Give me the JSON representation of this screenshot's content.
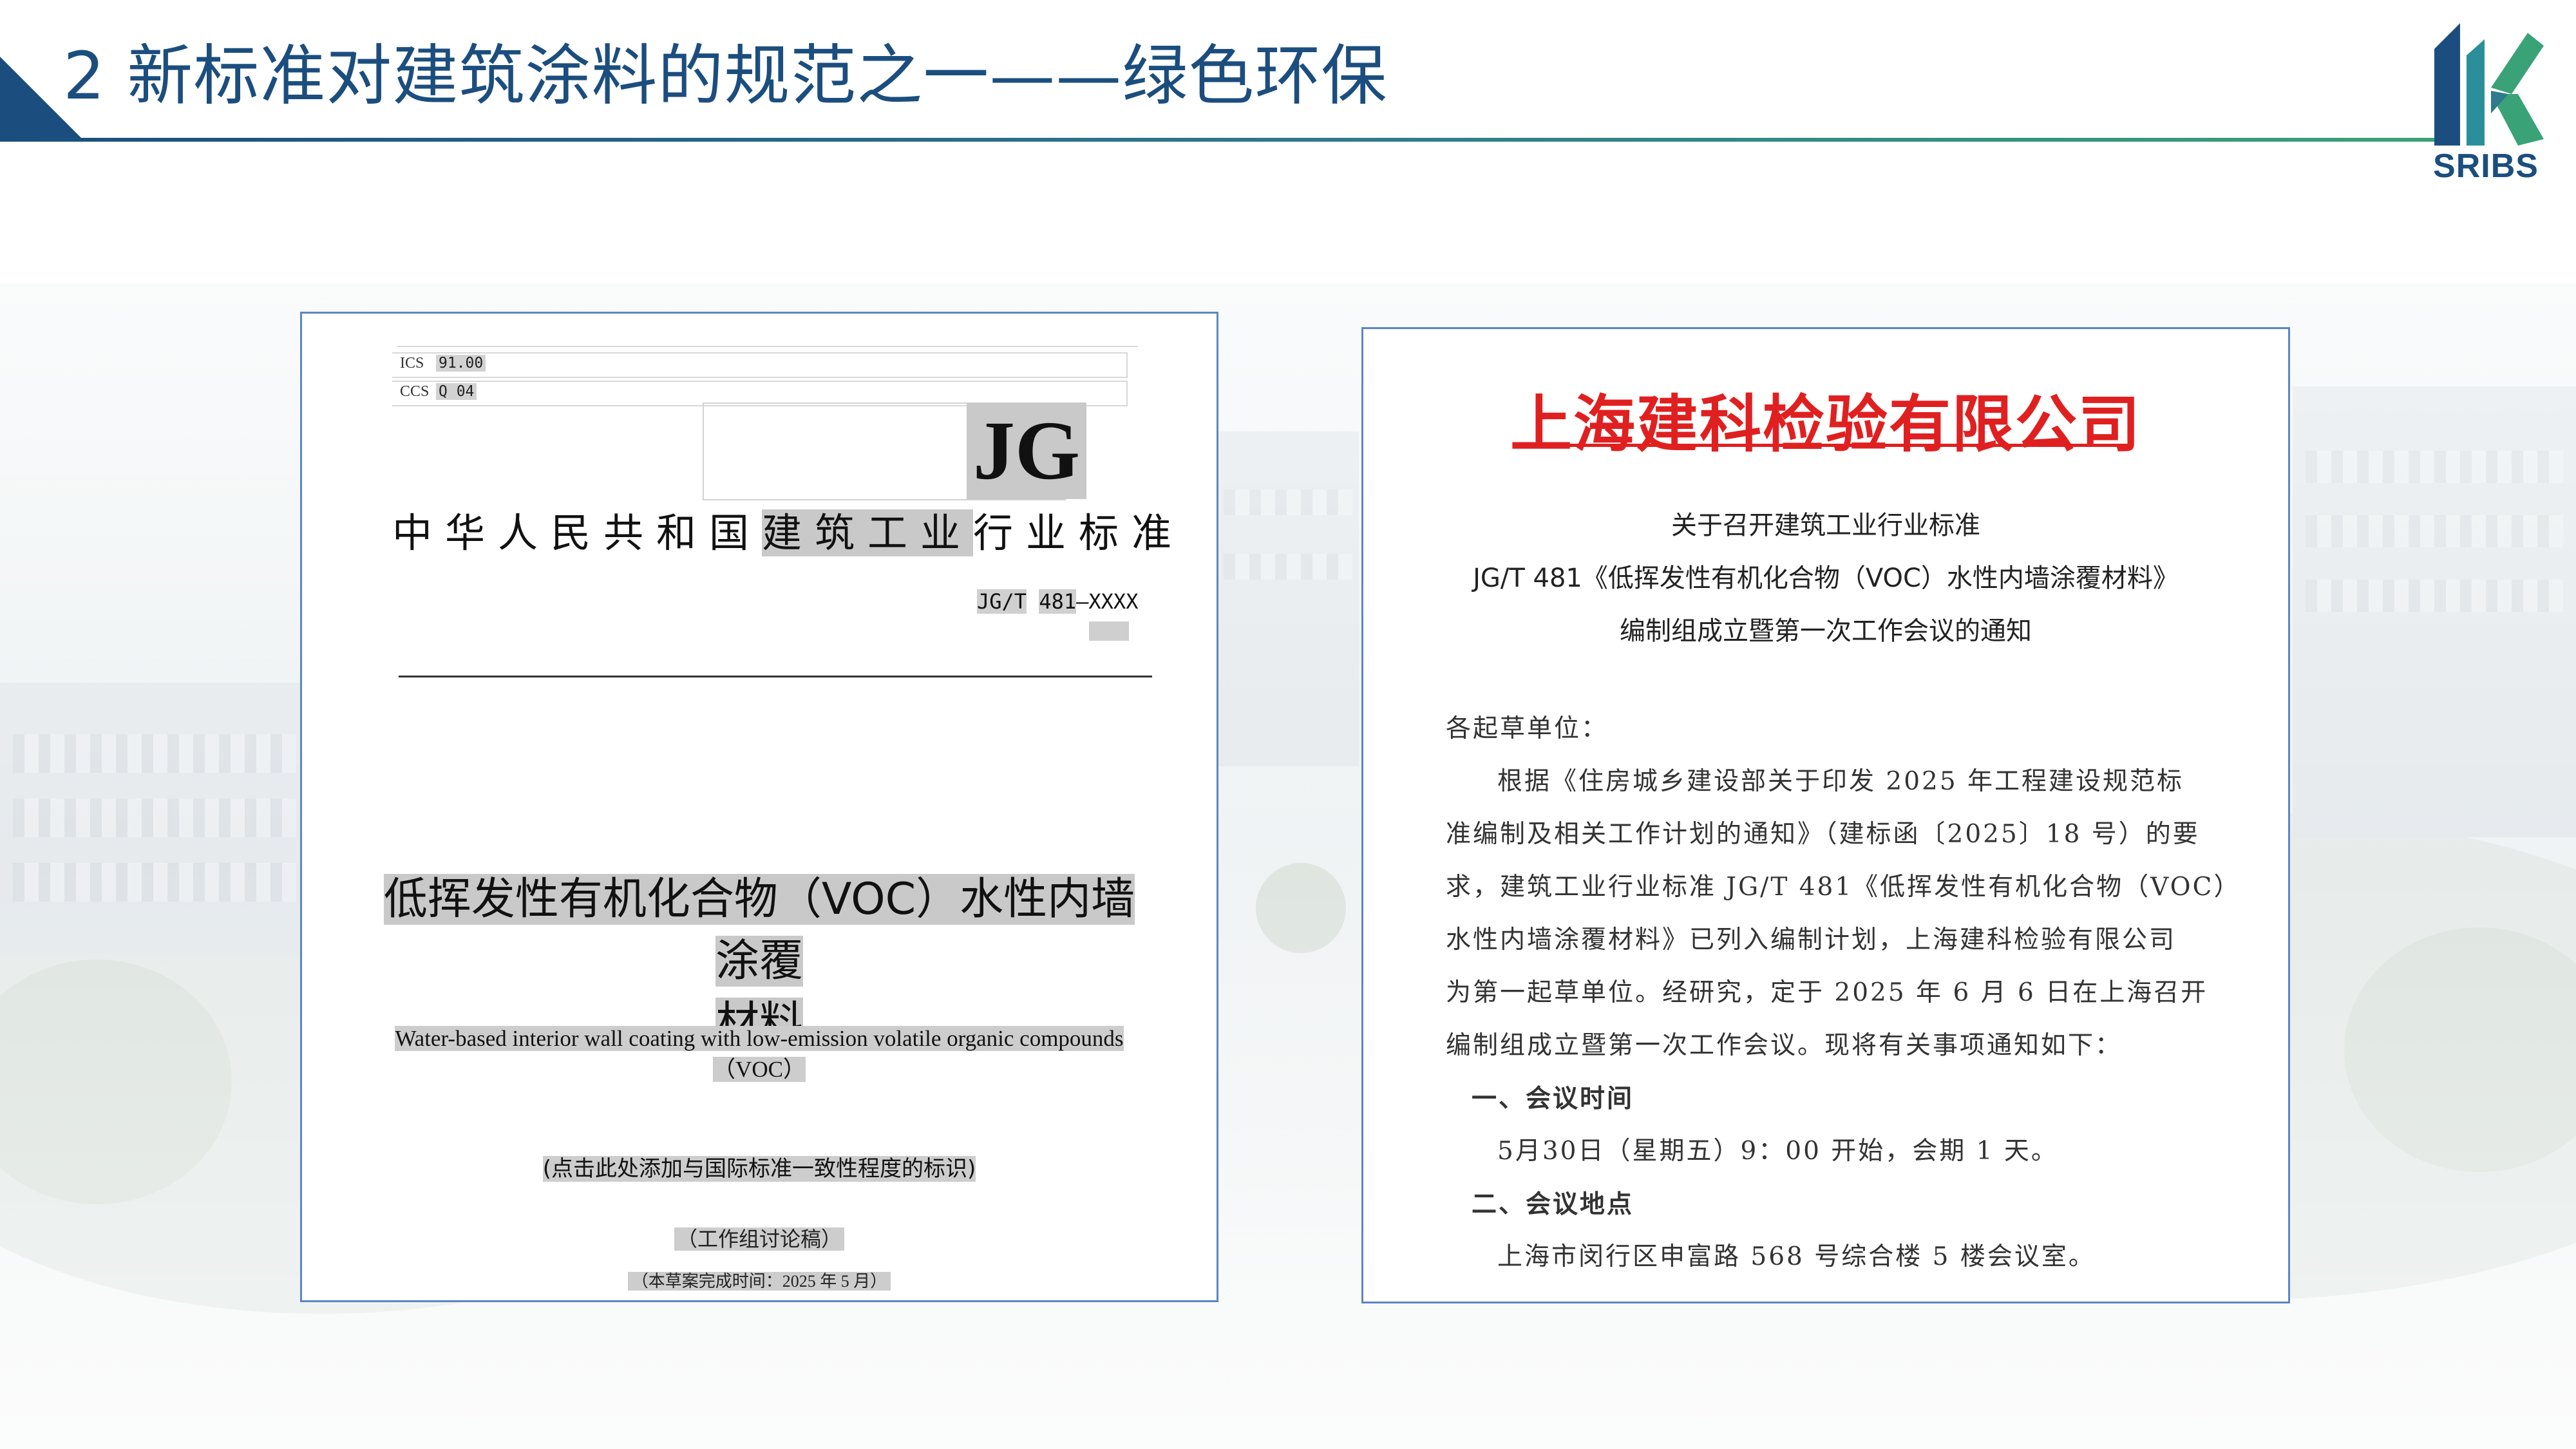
{
  "slide": {
    "title": "2 新标准对建筑涂料的规范之一——绿色环保",
    "logo_text": "SRIBS",
    "colors": {
      "primary": "#1b4e7e",
      "accent_green": "#3aa277",
      "doc_border": "#5b86c4",
      "org_red": "#e02020"
    }
  },
  "left_doc": {
    "ics_label": "ICS",
    "ics_value": "91.00",
    "ccs_label": "CCS",
    "ccs_value": "Q 04",
    "jg": "JG",
    "industry_std_a": "中华人民共和国",
    "industry_std_b": "建筑工业",
    "industry_std_c": "行业标准",
    "std_prefix": "JG/T",
    "std_number": "481",
    "std_suffix": "—XXXX",
    "title_cn_line1": "低挥发性有机化合物（VOC）水性内墙涂覆",
    "title_cn_line2": "材料",
    "title_en_line1": "Water-based interior wall coating with low-emission volatile organic compounds",
    "title_en_line2": "（VOC）",
    "iso_note": "(点击此处添加与国际标准一致性程度的标识)",
    "draft": "（工作组讨论稿）",
    "completed": "（本草案完成时间：2025 年 5 月）"
  },
  "right_doc": {
    "org": "上海建科检验有限公司",
    "notice_line1": "关于召开建筑工业行业标准",
    "notice_line2": "JG/T 481《低挥发性有机化合物（VOC）水性内墙涂覆材料》",
    "notice_line3": "编制组成立暨第一次工作会议的通知",
    "salutation": "各起草单位：",
    "p1_l1": "根据《住房城乡建设部关于印发 2025 年工程建设规范标",
    "p1_l2": "准编制及相关工作计划的通知》（建标函〔2025〕18 号）的要",
    "p1_l3": "求，建筑工业行业标准 JG/T 481《低挥发性有机化合物（VOC）",
    "p1_l4": "水性内墙涂覆材料》已列入编制计划，上海建科检验有限公司",
    "p1_l5": "为第一起草单位。经研究，定于 2025 年 6 月 6 日在上海召开",
    "p1_l6": "编制组成立暨第一次工作会议。现将有关事项通知如下：",
    "sec1": "一、会议时间",
    "time": "5月30日（星期五）9：00 开始，会期 1 天。",
    "sec2": "二、会议地点",
    "place": "上海市闵行区申富路 568 号综合楼 5 楼会议室。"
  }
}
